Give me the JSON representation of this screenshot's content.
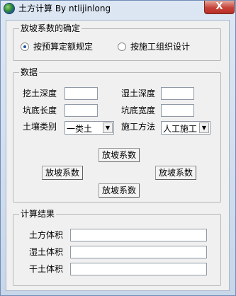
{
  "window": {
    "title": "土方计算 By ntlijinlong",
    "close_label": "X",
    "icon": "globe-app-icon"
  },
  "slope_mode": {
    "legend": "放坡系数的确定",
    "options": [
      {
        "label": "按预算定额规定",
        "selected": true
      },
      {
        "label": "按施工组织设计",
        "selected": false
      }
    ]
  },
  "data_group": {
    "legend": "数据",
    "dig_depth_label": "挖土深度",
    "wet_depth_label": "湿土深度",
    "pit_length_label": "坑底长度",
    "pit_width_label": "坑底宽度",
    "soil_type_label": "土壤类别",
    "soil_type_value": "一类土",
    "method_label": "施工方法",
    "method_value": "人工施工",
    "slope_top": "放坡系数",
    "slope_left": "放坡系数",
    "slope_right": "放坡系数",
    "slope_bottom": "放坡系数"
  },
  "results": {
    "legend": "计算结果",
    "earth_volume_label": "土方体积",
    "wet_volume_label": "湿土体积",
    "dry_volume_label": "干土体积"
  }
}
